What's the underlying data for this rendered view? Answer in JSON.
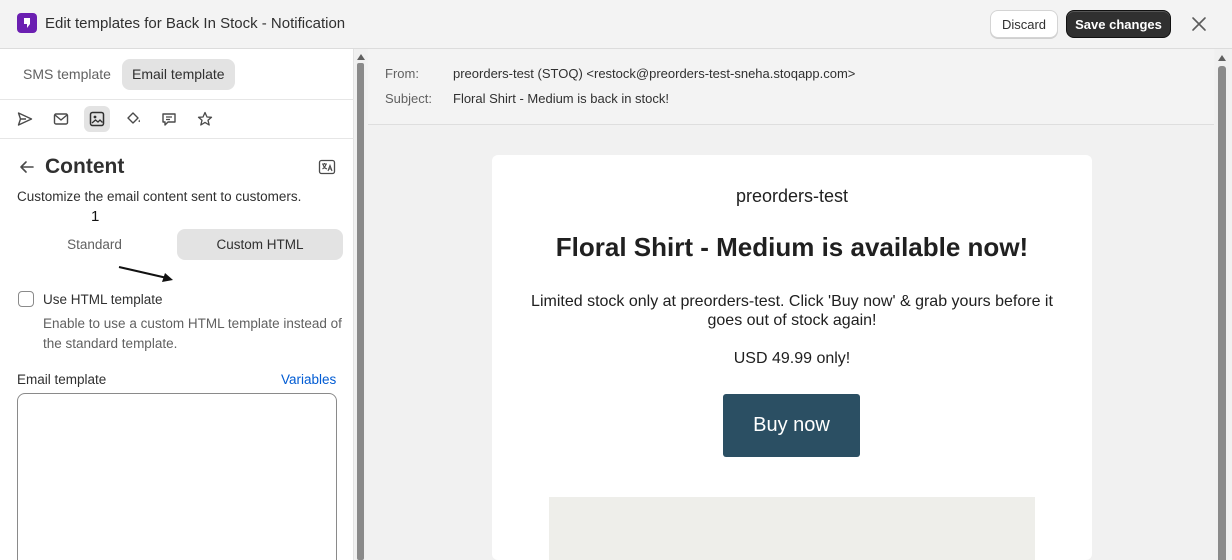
{
  "header": {
    "title": "Edit templates for Back In Stock - Notification",
    "discard_label": "Discard",
    "save_label": "Save changes"
  },
  "left_panel": {
    "tabs": [
      {
        "label": "SMS template",
        "active": false
      },
      {
        "label": "Email template",
        "active": true
      }
    ],
    "toolbar_icons": [
      "send-icon",
      "envelope-icon",
      "content-image-icon",
      "paint-bucket-icon",
      "chat-bubble-icon",
      "star-icon"
    ],
    "active_icon_index": 2,
    "section_title": "Content",
    "description": "Customize the email content sent to customers.",
    "annotation_number": "1",
    "segment": {
      "options": [
        "Standard",
        "Custom HTML"
      ],
      "selected": "Custom HTML"
    },
    "use_html_template": {
      "label": "Use HTML template",
      "checked": false,
      "help": "Enable to use a custom HTML template instead of the standard template."
    },
    "email_template": {
      "label": "Email template",
      "variables_link": "Variables",
      "value": ""
    }
  },
  "preview": {
    "from_label": "From:",
    "from_value": "preorders-test (STOQ) <restock@preorders-test-sneha.stoqapp.com>",
    "subject_label": "Subject:",
    "subject_value": "Floral Shirt - Medium is back in stock!",
    "email": {
      "shop_name": "preorders-test",
      "headline": "Floral Shirt - Medium is available now!",
      "body": "Limited stock only at preorders-test. Click 'Buy now' & grab yours before it goes out of stock again!",
      "price": "USD 49.99 only!",
      "button_label": "Buy now",
      "button_color": "#2b4f63"
    }
  },
  "colors": {
    "brand": "#6b1fb1",
    "primary_button": "#303030",
    "link": "#005bd3"
  }
}
